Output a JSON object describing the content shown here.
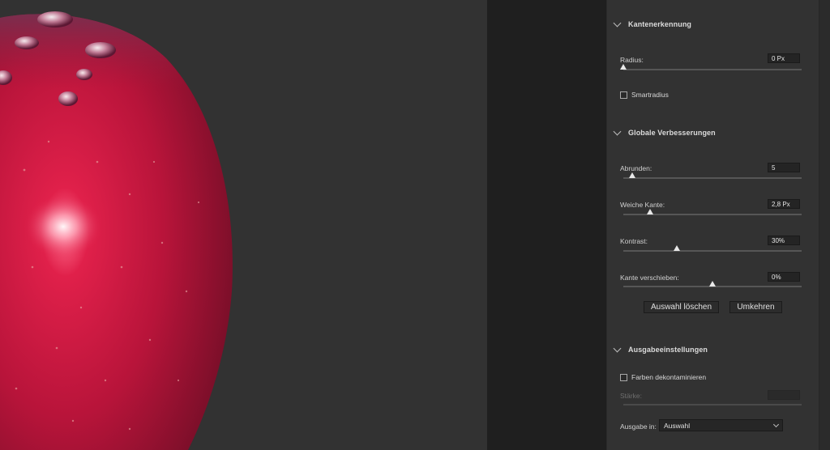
{
  "canvas": {
    "image_subject": "red apple with water droplets",
    "colors": {
      "background": "#323232",
      "apple": "#b8143a"
    }
  },
  "panel": {
    "edge_detection": {
      "title": "Kantenerkennung",
      "radius": {
        "label": "Radius:",
        "value": "0 Px",
        "slider_fraction": 0.0
      },
      "smart_radius": {
        "label": "Smartradius",
        "checked": false
      }
    },
    "global_refinements": {
      "title": "Globale Verbesserungen",
      "smooth": {
        "label": "Abrunden:",
        "value": "5",
        "slider_fraction": 0.05
      },
      "feather": {
        "label": "Weiche Kante:",
        "value": "2,8 Px",
        "slider_fraction": 0.15
      },
      "contrast": {
        "label": "Kontrast:",
        "value": "30%",
        "slider_fraction": 0.3
      },
      "shift_edge": {
        "label": "Kante verschieben:",
        "value": "0%",
        "slider_fraction": 0.5
      },
      "clear_selection_label": "Auswahl löschen",
      "invert_label": "Umkehren"
    },
    "output_settings": {
      "title": "Ausgabeeinstellungen",
      "decontaminate": {
        "label": "Farben dekontaminieren",
        "checked": false
      },
      "amount": {
        "label": "Stärke:",
        "value": ""
      },
      "output_to": {
        "label": "Ausgabe in:",
        "value": "Auswahl"
      }
    }
  }
}
